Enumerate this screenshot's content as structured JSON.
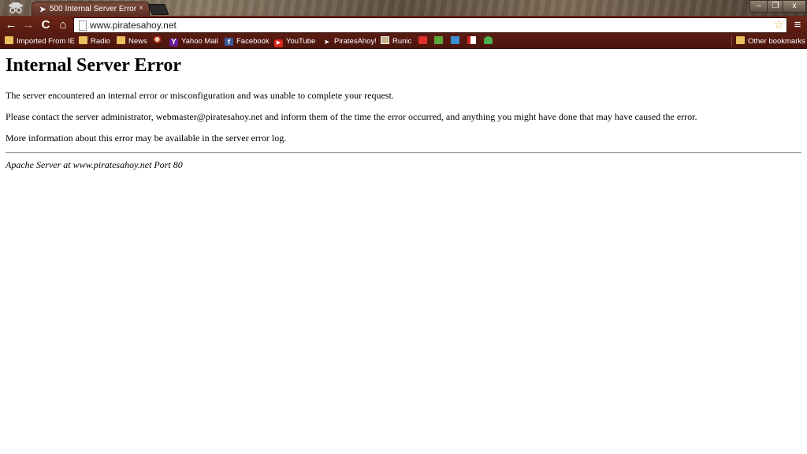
{
  "browser": {
    "tab": {
      "title": "500 Internal Server Error",
      "close_glyph": "×"
    },
    "window_controls": {
      "minimize": "–",
      "maximize": "❐",
      "close": "x"
    },
    "nav": {
      "back": "←",
      "forward": "→",
      "reload": "C",
      "home": "⌂",
      "menu": "≡"
    },
    "address_bar": {
      "url": "www.piratesahoy.net"
    },
    "star_glyph": "☆",
    "bookmarks": [
      {
        "label": "Imported From IE",
        "icon": "folder-icon"
      },
      {
        "label": "Radio",
        "icon": "folder-icon"
      },
      {
        "label": "News",
        "icon": "folder-icon"
      },
      {
        "label": "",
        "icon": "pirate-favicon-icon"
      },
      {
        "label": "Yahoo Mail",
        "icon": "yahoo-icon"
      },
      {
        "label": "Facebook",
        "icon": "facebook-icon"
      },
      {
        "label": "YouTube",
        "icon": "youtube-icon"
      },
      {
        "label": "PiratesAhoy!",
        "icon": "piratesahoy-icon"
      },
      {
        "label": "Runic",
        "icon": "runic-icon"
      }
    ],
    "other_bookmarks": "Other bookmarks",
    "colors": {
      "toolbar": "#6a2618",
      "bookmarks_bar": "#5a1c12",
      "tab": "#5b2e22"
    }
  },
  "page": {
    "heading": "Internal Server Error",
    "paragraphs": [
      "The server encountered an internal error or misconfiguration and was unable to complete your request.",
      "Please contact the server administrator, webmaster@piratesahoy.net and inform them of the time the error occurred, and anything you might have done that may have caused the error.",
      "More information about this error may be available in the server error log."
    ],
    "signature": "Apache Server at www.piratesahoy.net Port 80"
  }
}
